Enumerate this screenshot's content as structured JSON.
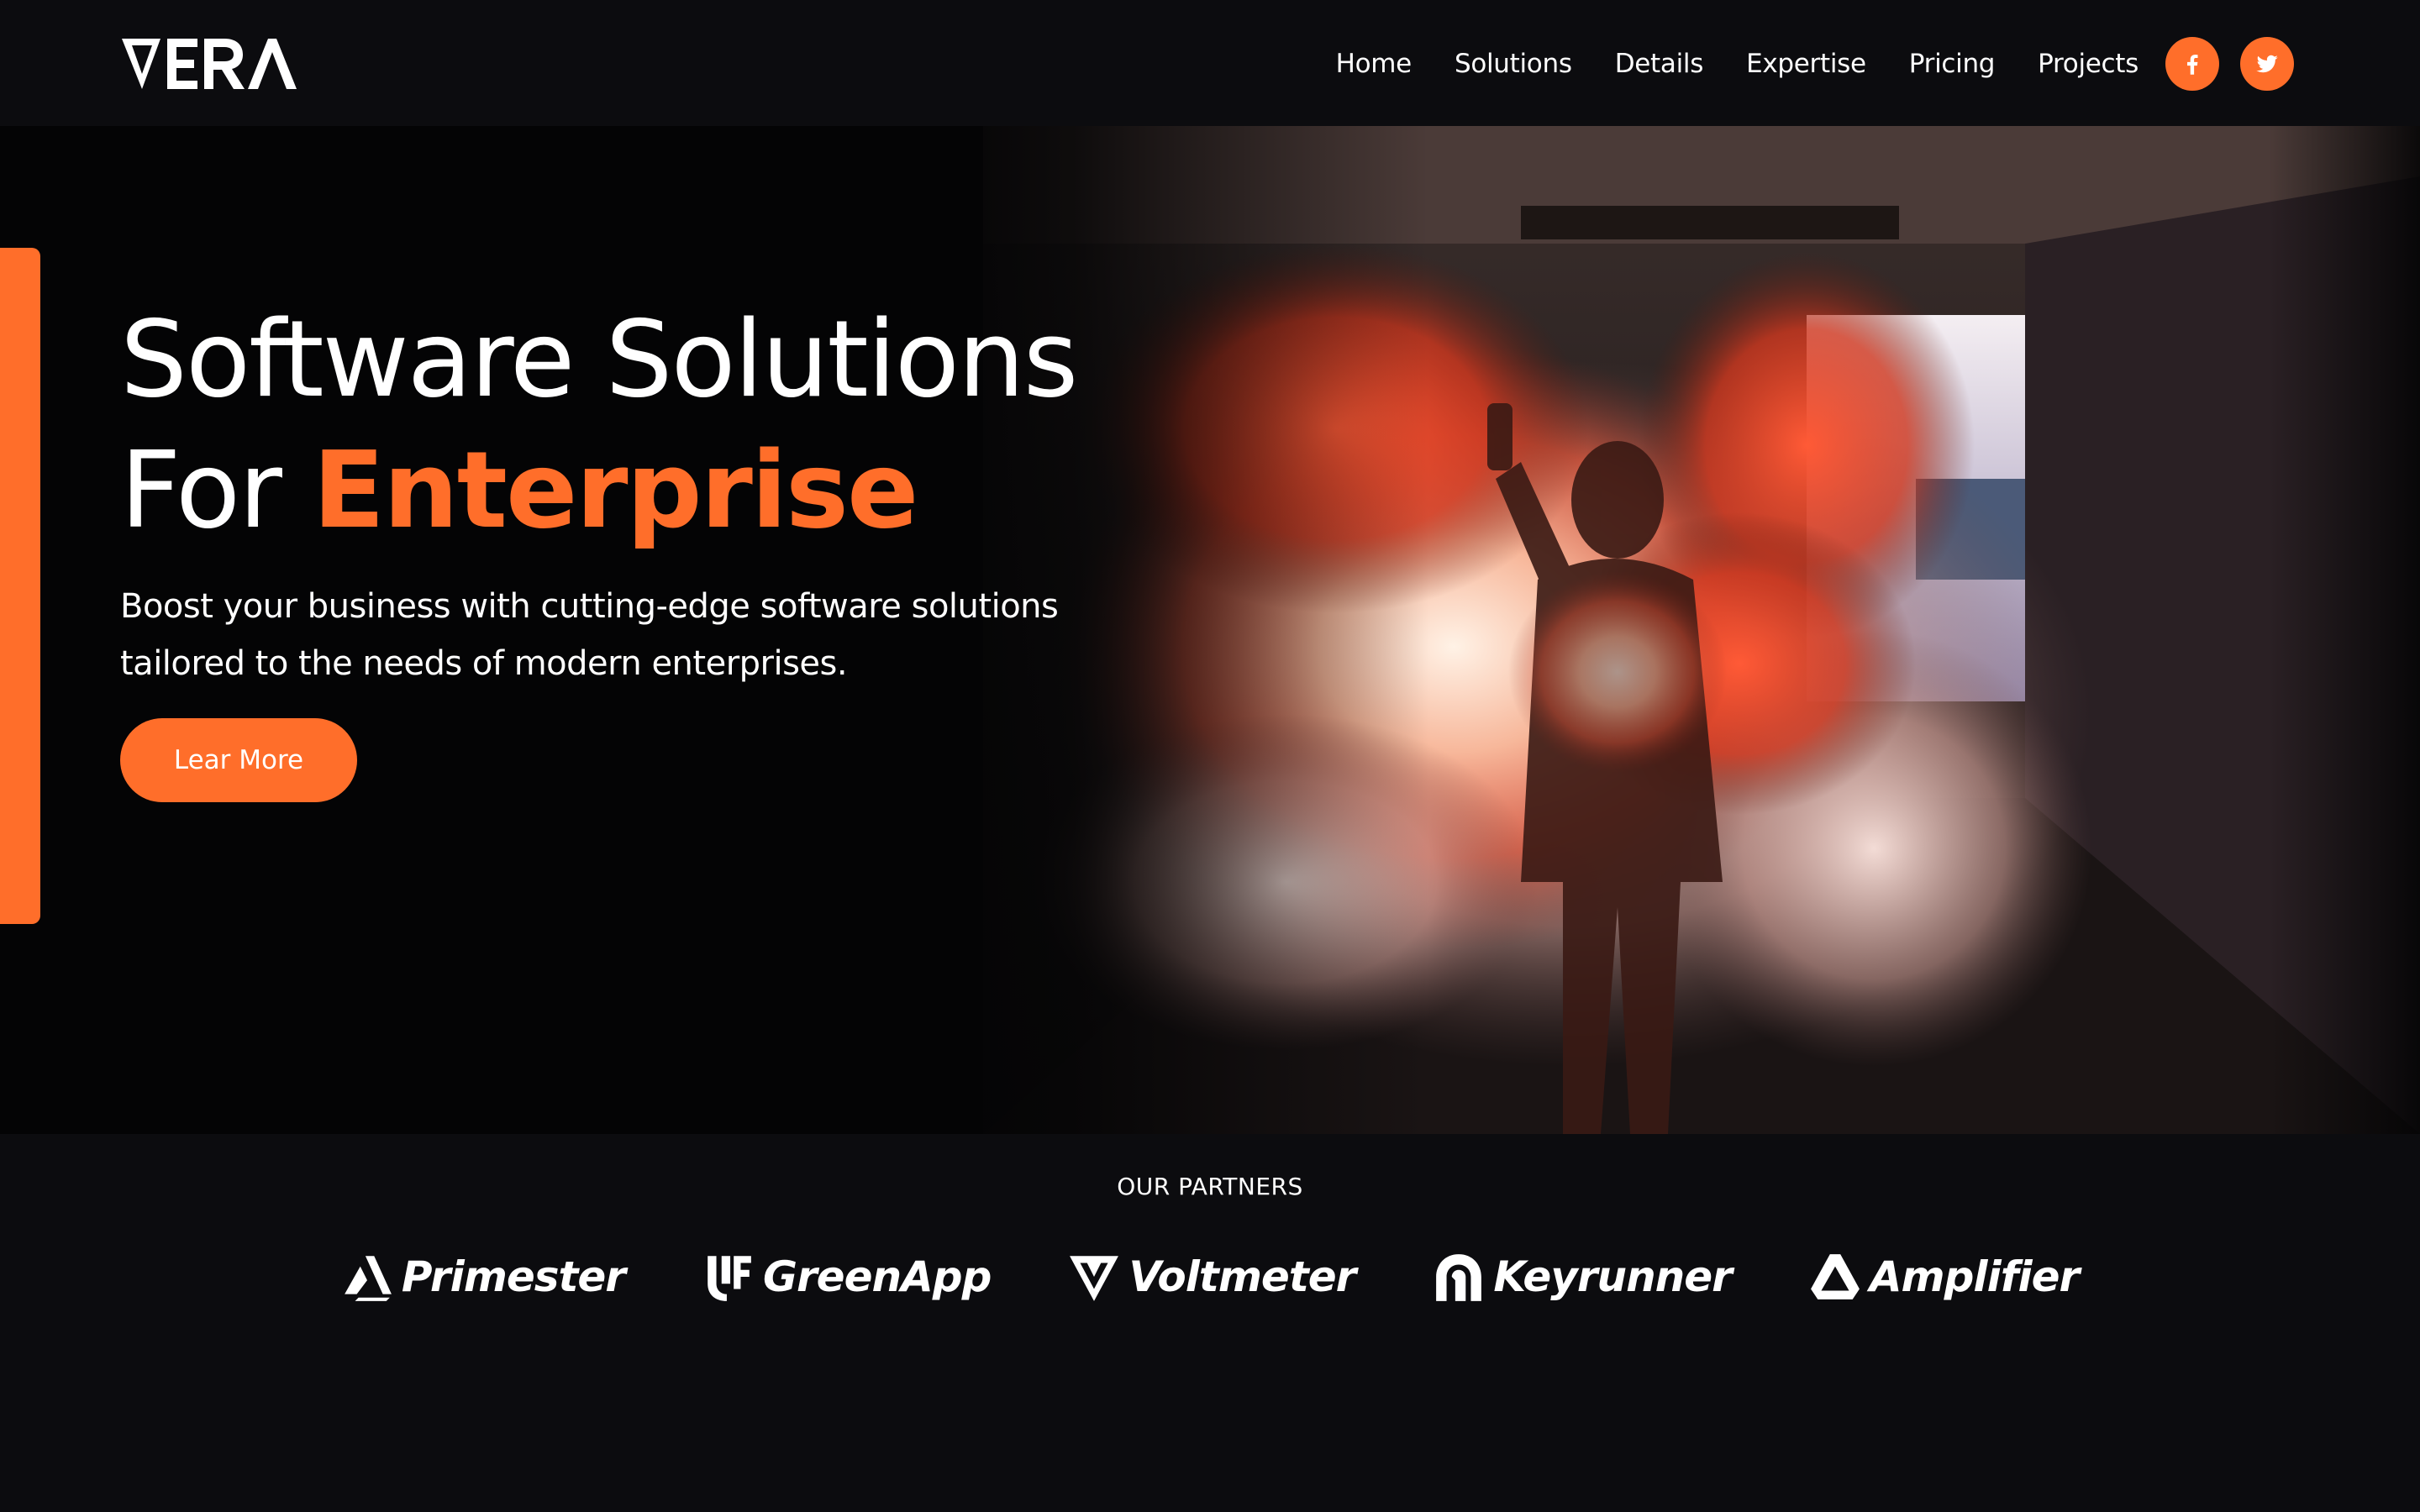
{
  "brand": {
    "logo_text": "VERA",
    "accent_color": "#ff6e2a",
    "background_color": "#0c0c0f"
  },
  "nav": {
    "items": [
      {
        "label": "Home"
      },
      {
        "label": "Solutions"
      },
      {
        "label": "Details"
      },
      {
        "label": "Expertise"
      },
      {
        "label": "Pricing"
      },
      {
        "label": "Projects"
      }
    ],
    "social": [
      {
        "icon": "facebook-icon"
      },
      {
        "icon": "twitter-icon"
      }
    ]
  },
  "hero": {
    "title_line1": "Software Solutions",
    "title_line2_prefix": "For ",
    "title_line2_accent": "Enterprise",
    "subtitle_line1": "Boost your business with cutting-edge software solutions",
    "subtitle_line2": "tailored to the needs of modern enterprises.",
    "cta_label": "Lear More",
    "image": "person holding orange smoke flare in tunnel"
  },
  "partners": {
    "heading": "OUR PARTNERS",
    "items": [
      {
        "name": "Primester",
        "icon": "primester-logo-icon"
      },
      {
        "name": "GreenApp",
        "icon": "greenapp-logo-icon"
      },
      {
        "name": "Voltmeter",
        "icon": "voltmeter-logo-icon"
      },
      {
        "name": "Keyrunner",
        "icon": "keyrunner-logo-icon"
      },
      {
        "name": "Amplifier",
        "icon": "amplifier-logo-icon"
      }
    ]
  }
}
